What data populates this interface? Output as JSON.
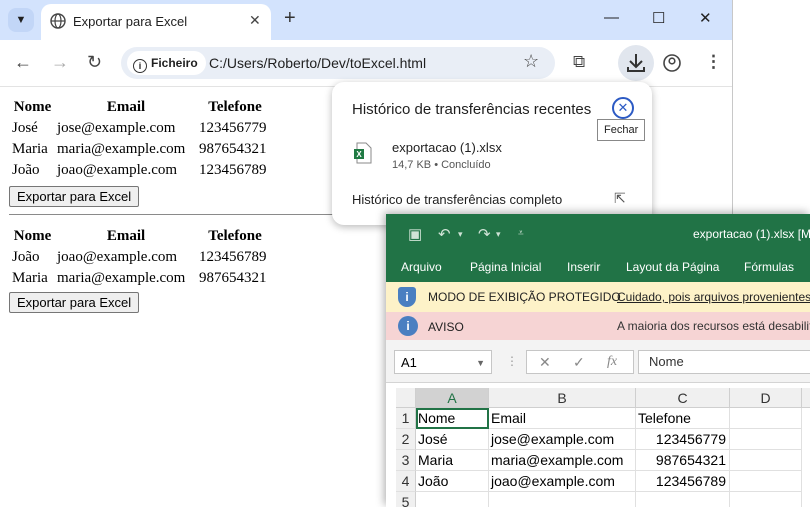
{
  "browser": {
    "tab_title": "Exportar para Excel",
    "address_chip": "Ficheiro",
    "url": "C:/Users/Roberto/Dev/toExcel.html"
  },
  "page": {
    "table1": {
      "headers": [
        "Nome",
        "Email",
        "Telefone"
      ],
      "rows": [
        [
          "José",
          "jose@example.com",
          "123456779"
        ],
        [
          "Maria",
          "maria@example.com",
          "987654321"
        ],
        [
          "João",
          "joao@example.com",
          "123456789"
        ]
      ]
    },
    "table2": {
      "headers": [
        "Nome",
        "Email",
        "Telefone"
      ],
      "rows": [
        [
          "João",
          "joao@example.com",
          "123456789"
        ],
        [
          "Maria",
          "maria@example.com",
          "987654321"
        ]
      ]
    },
    "export_button": "Exportar para Excel"
  },
  "downloads": {
    "title": "Histórico de transferências recentes",
    "file_name": "exportacao (1).xlsx",
    "file_meta": "14,7 KB • Concluído",
    "full_history": "Histórico de transferências completo",
    "close_tooltip": "Fechar"
  },
  "excel": {
    "window_title": "exportacao (1).xlsx  [M",
    "ribbon_tabs": [
      "Arquivo",
      "Página Inicial",
      "Inserir",
      "Layout da Página",
      "Fórmulas"
    ],
    "protected_label": "MODO DE EXIBIÇÃO PROTEGIDO",
    "protected_link": "Cuidado, pois arquivos provenientes",
    "warning_label": "AVISO",
    "warning_message": "A maioria dos recursos está desabilit",
    "name_box": "A1",
    "fx": "fx",
    "formula_value": "Nome",
    "columns": [
      "A",
      "B",
      "C",
      "D"
    ],
    "row_numbers": [
      "1",
      "2",
      "3",
      "4",
      "5"
    ],
    "cells": [
      [
        "Nome",
        "Email",
        "Telefone",
        ""
      ],
      [
        "José",
        "jose@example.com",
        "123456779",
        ""
      ],
      [
        "Maria",
        "maria@example.com",
        "987654321",
        ""
      ],
      [
        "João",
        "joao@example.com",
        "123456789",
        ""
      ],
      [
        "",
        "",
        "",
        ""
      ]
    ]
  }
}
